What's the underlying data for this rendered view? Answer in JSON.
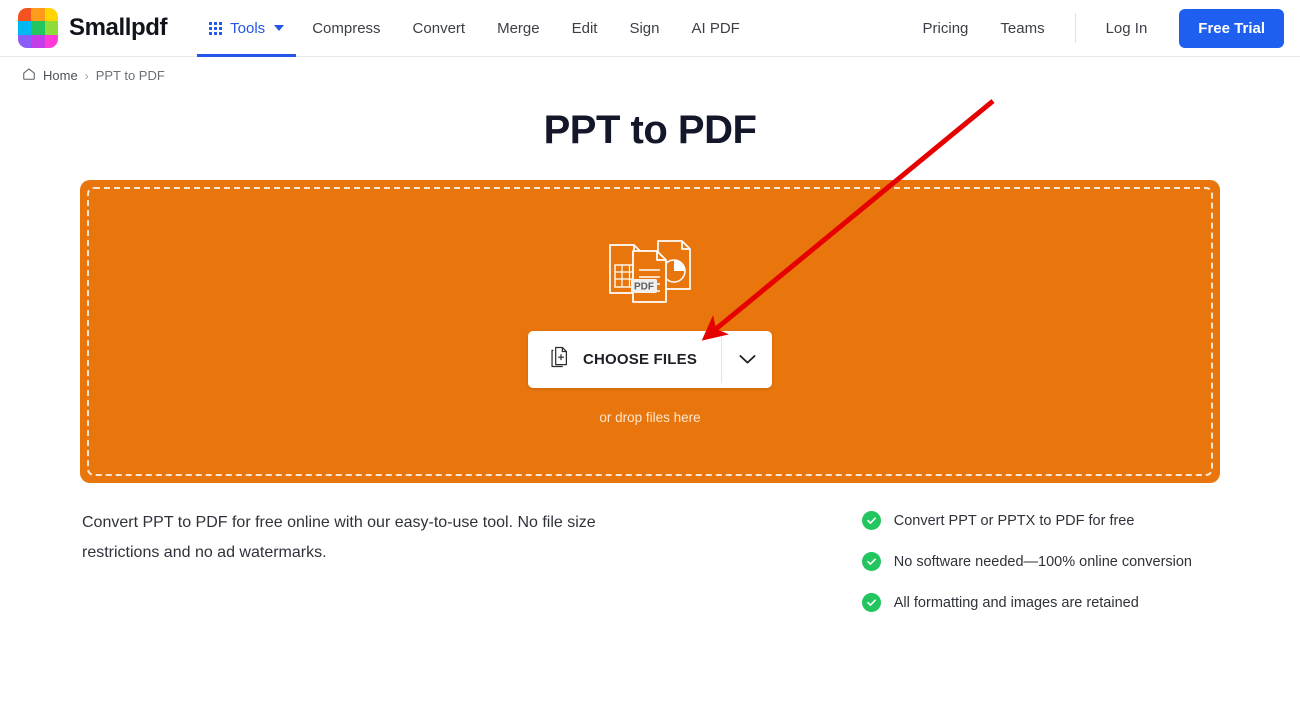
{
  "header": {
    "brand_name": "Smallpdf",
    "logo_colors": [
      "#f4531f",
      "#ff9b1a",
      "#ffd400",
      "#00b9f1",
      "#22c55e",
      "#8ddc3a",
      "#8b5cf6",
      "#c23ce8",
      "#ff3ad6"
    ],
    "tools": {
      "label": "Tools",
      "icon": "grid-dots-icon",
      "caret": "chevron-down-icon"
    },
    "nav_links": [
      "Compress",
      "Convert",
      "Merge",
      "Edit",
      "Sign",
      "AI PDF"
    ],
    "right_links": [
      "Pricing",
      "Teams"
    ],
    "login_label": "Log In",
    "trial_label": "Free Trial",
    "accent_color": "#1f5ff0"
  },
  "breadcrumb": {
    "home_icon": "home-icon",
    "home_label": "Home",
    "separator": "›",
    "current": "PPT to PDF"
  },
  "page": {
    "title": "PPT to PDF"
  },
  "dropzone": {
    "background_color": "#e8760d",
    "icon_name": "ppt-to-pdf-documents-icon",
    "pdf_badge": "PDF",
    "choose_label": "CHOOSE FILES",
    "choose_icon": "file-add-icon",
    "caret_icon": "chevron-down-icon",
    "hint": "or drop files here"
  },
  "description": "Convert PPT to PDF for free online with our easy-to-use tool. No file size restrictions and no ad watermarks.",
  "features": {
    "check_color": "#22c55e",
    "items": [
      "Convert PPT or PPTX to PDF for free",
      "No software needed—100% online conversion",
      "All formatting and images are retained"
    ]
  },
  "annotation": {
    "arrow_color": "#e60000",
    "from": "993,101",
    "to": "705,337"
  }
}
